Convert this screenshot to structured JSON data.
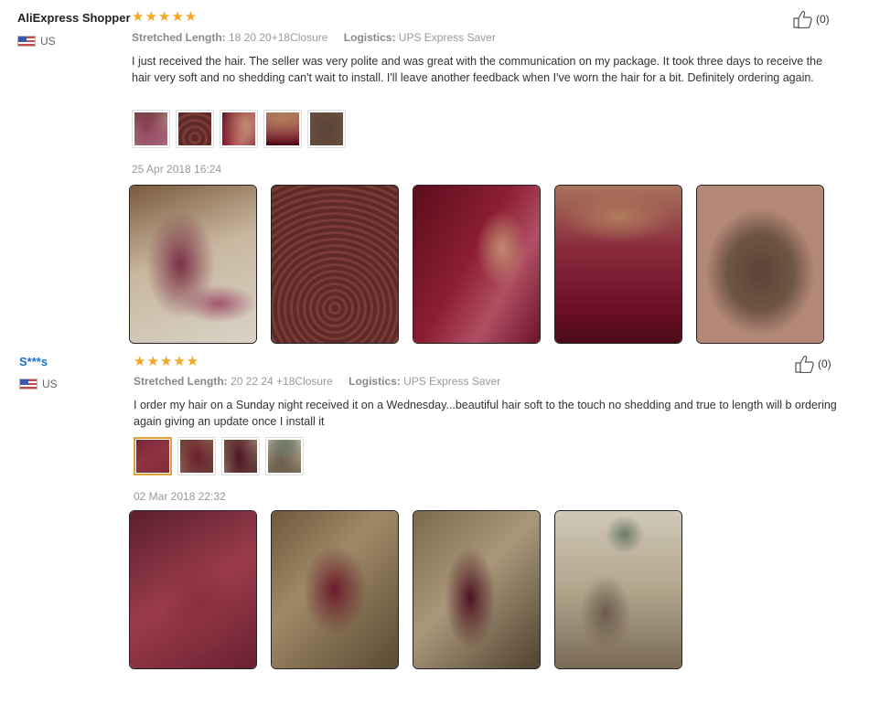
{
  "reviews": [
    {
      "user": "AliExpress Shopper",
      "country": "US",
      "stars": "★★★★★",
      "rating": 5,
      "stretched_label": "Stretched Length:",
      "stretched_value": "18 20 20+18Closure",
      "logistics_label": "Logistics:",
      "logistics_value": "UPS Express Saver",
      "text": "I just received the hair. The seller was very polite and was great with the communication on my package. It took three days to receive the hair very soft and no shedding can't wait to install. I'll leave another feedback when I've worn the hair for a bit. Definitely ordering again.",
      "date": "25 Apr 2018 16:24",
      "helpful": "(0)"
    },
    {
      "user": "S***s",
      "country": "US",
      "stars": "★★★★★",
      "rating": 5,
      "stretched_label": "Stretched Length:",
      "stretched_value": "20 22 24 +18Closure",
      "logistics_label": "Logistics:",
      "logistics_value": "UPS Express Saver",
      "text": "I order my hair on a Sunday night received it on a Wednesday...beautiful hair soft to the touch no shedding and true to length will b ordering again giving an update once I install it",
      "date": "02 Mar 2018 22:32",
      "helpful": "(0)"
    }
  ],
  "icons": {
    "thumbs_up": "thumbs-up-icon",
    "flag": "us-flag-icon",
    "star": "star-icon"
  },
  "colors": {
    "star": "#f5a623",
    "link": "#1a6dcc",
    "active_thumb_border": "#e0a33a"
  }
}
